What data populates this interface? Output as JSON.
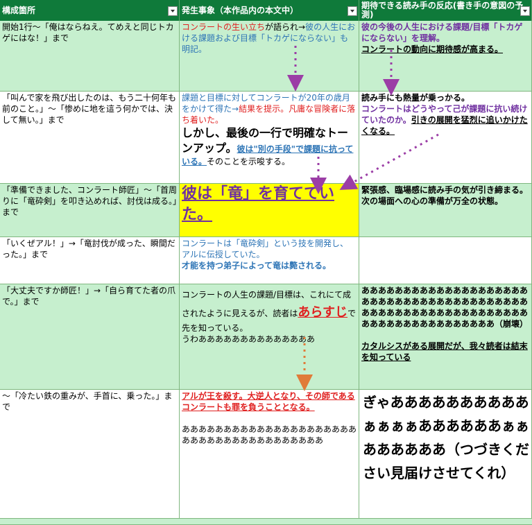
{
  "headers": [
    "構成箇所",
    "発生事象（本作品内の本文中）",
    "期待できる読み手の反応(書き手の意図の予測)"
  ],
  "rows": [
    {
      "c1": "開始1行〜「俺はならねえ。てめえと同じトカゲにはな！」まで",
      "c2a": "コンラートの生い立ち",
      "c2b": "が語られ→",
      "c2c": "彼の人生における課題および目標「トカゲにならない」",
      "c2d": "も明記。",
      "c3a": "彼の今後の人生における課題/目標「トカゲにならない」を理解。",
      "c3b": "コンラートの動向に期待感が高まる。"
    },
    {
      "c1": "「叫んで家を飛び出したのは、もう二十何年も前のこと。」〜「惨めに地を這う何かでは、決して無い。」まで",
      "c2a": "課題と目標に対してコンラートが20年の歳月をかけて得た→",
      "c2b": "結果を提示。凡庸な冒険者に落ち着いた。",
      "c2c": "しかし、最後の一行で明確なトーンアップ。",
      "c2d": "彼は\"別の手段\"で課題に抗っている。",
      "c2e": "そのことを示唆する。",
      "c3a": "読み手にも熱量が乗っかる。",
      "c3b": "コンラートはどうやって己が課題に抗い続けていたのか。",
      "c3c": "引きの展開を猛烈に追いかけたくなる。"
    },
    {
      "c1": "「準備できました、コンラート師匠」〜「首周りに「竜砕剣」を叩き込めれば、討伐は成る。」まで",
      "c2a": "彼は「竜」を育てていた。",
      "c3a": "緊張感、臨場感に読み手の気が引き締まる。",
      "c3b": "次の場面への心の準備が万全の状態。"
    },
    {
      "c1": "「いくぜアル！」→「竜討伐が成った、瞬間だった。」まで",
      "c2a": "コンラートは「竜砕剣」という技を開発し、アルに伝授していた。",
      "c2b": "才能を持つ弟子によって竜は斃される。"
    },
    {
      "c1": "「大丈夫ですか師匠！」→「自ら育てた者の爪で。」まで",
      "c2a": "コンラートの人生の課題/目標は、これにて成されたように見えるが、読者は",
      "c2b": "あらすじ",
      "c2c": "で先を知っている。",
      "c2d": "うわああああああああああああああ",
      "c3a": "ああああああああああああああああああああああああああああああああああああああああああああああああああああああああああああああああああああああああああああ（崩壊）",
      "c3b": "カタルシスがある展開だが、我々読者は結末を知っている"
    },
    {
      "c1": "〜「冷たい鉄の重みが、手首に、乗った。」まで",
      "c2a": "アルが王を殺す。大逆人となり、その師であるコンラートも罪を負うこととなる。",
      "c2b": "ああああああああああああああああああああああああああああああああああああああ",
      "c3a": "ぎゃああああああああああぁぁぁぁああああああぁぁああああああ（つづきください見届けさせてくれ）"
    }
  ],
  "colors": {
    "header": "#0f7a3a",
    "green": "#c6efce",
    "yellow": "#ffff00",
    "red": "#e02020",
    "blue": "#2e75b6",
    "purple": "#7030a0",
    "arrow_purple": "#9b3da6",
    "arrow_orange": "#e07b39"
  }
}
